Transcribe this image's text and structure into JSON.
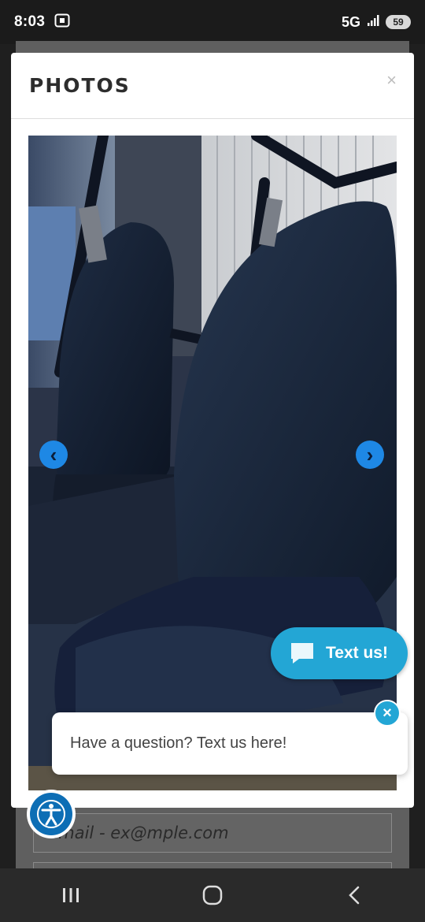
{
  "status_bar": {
    "time": "8:03",
    "network": "5G",
    "battery": "59"
  },
  "modal": {
    "title": "PHOTOS",
    "close_glyph": "×"
  },
  "gallery": {
    "prev_glyph": "‹",
    "next_glyph": "›"
  },
  "chat_widget": {
    "button_label": "Text us!",
    "bubble_text": "Have a question? Text us here!",
    "close_glyph": "×"
  },
  "background_form": {
    "email_placeholder": "Email - ex@mple.com"
  },
  "colors": {
    "accent": "#23a6d5",
    "nav_arrow": "#1e88e5",
    "a11y": "#0d6eb5"
  }
}
